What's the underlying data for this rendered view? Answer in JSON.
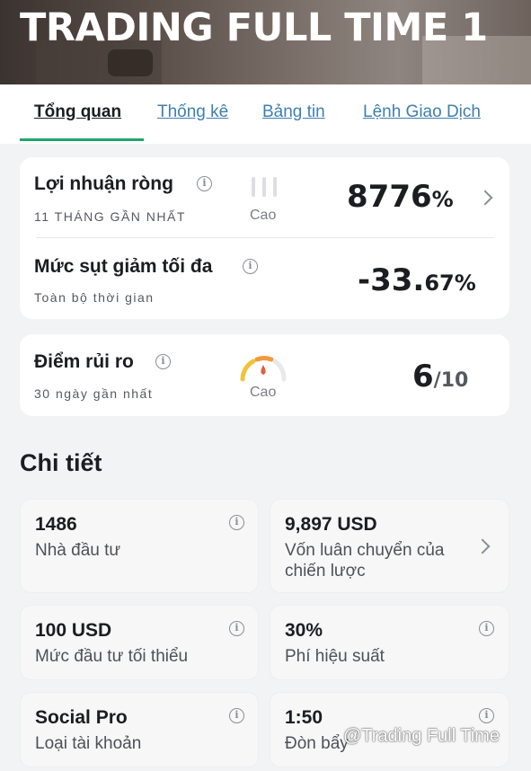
{
  "banner": {
    "title": "TRADING FULL TIME 1"
  },
  "tabs": [
    {
      "label": "Tổng quan",
      "active": true
    },
    {
      "label": "Thống kê",
      "active": false
    },
    {
      "label": "Bảng tin",
      "active": false
    },
    {
      "label": "Lệnh Giao Dịch",
      "active": false
    }
  ],
  "profit": {
    "title": "Lợi nhuận ròng",
    "period": "11 THÁNG GẦN NHẤT",
    "level": "Cao",
    "value": "8776",
    "unit": "%"
  },
  "drawdown": {
    "title": "Mức sụt giảm tối đa",
    "period": "Toàn bộ thời gian",
    "value_main": "-33.",
    "value_decimals": "67%"
  },
  "risk": {
    "title": "Điểm rủi ro",
    "period": "30 ngày gần nhất",
    "level": "Cao",
    "score": "6",
    "max": "/10"
  },
  "details": {
    "title": "Chi tiết",
    "tiles": [
      {
        "value": "1486",
        "label": "Nhà đầu tư"
      },
      {
        "value": "9,897 USD",
        "label": "Vốn luân chuyển của chiến lược"
      },
      {
        "value": "100 USD",
        "label": "Mức đầu tư tối thiểu"
      },
      {
        "value": "30%",
        "label": "Phí hiệu suất"
      },
      {
        "value": "Social Pro",
        "label": "Loại tài khoản"
      },
      {
        "value": "1:50",
        "label": "Đòn bẩy"
      }
    ]
  },
  "watermark": "@Trading Full Time",
  "colors": {
    "accent_green": "#1fa56b",
    "tab_link": "#3f7fb0",
    "risk_gauge_red": "#e35d3f"
  },
  "icons": [
    "info-icon",
    "chevron-right-icon",
    "risk-gauge-icon"
  ]
}
